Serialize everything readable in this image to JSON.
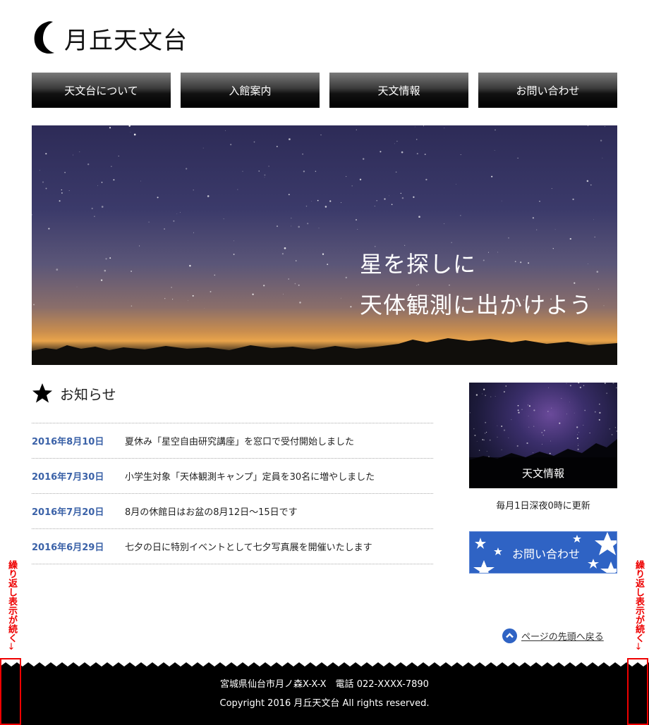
{
  "site": {
    "logo_text": "月丘天文台"
  },
  "nav": {
    "items": [
      {
        "label": "天文台について"
      },
      {
        "label": "入館案内"
      },
      {
        "label": "天文情報"
      },
      {
        "label": "お問い合わせ"
      }
    ]
  },
  "hero": {
    "line1": "星を探しに",
    "line2": "天体観測に出かけよう"
  },
  "news": {
    "title": "お知らせ",
    "items": [
      {
        "date": "2016年8月10日",
        "text": "夏休み「星空自由研究講座」を窓口で受付開始しました"
      },
      {
        "date": "2016年7月30日",
        "text": "小学生対象「天体観測キャンプ」定員を30名に増やしました"
      },
      {
        "date": "2016年7月20日",
        "text": "8月の休館日はお盆の8月12日〜15日です"
      },
      {
        "date": "2016年6月29日",
        "text": "七夕の日に特別イベントとして七夕写真展を開催いたします"
      }
    ]
  },
  "sidebar": {
    "card_label": "天文情報",
    "card_caption": "毎月1日深夜0時に更新",
    "contact_label": "お問い合わせ"
  },
  "page_top": {
    "label": "ページの先頭へ戻る"
  },
  "footer": {
    "address": "宮城県仙台市月ノ森X-X-X　電話 022-XXXX-7890",
    "copyright": "Copyright 2016 月丘天文台 All rights reserved."
  },
  "annotation": {
    "text": "繰り返し表示が続く"
  },
  "colors": {
    "accent_blue": "#2f63c4",
    "date_blue": "#3b62a8",
    "annotation_red": "#ee0000"
  }
}
